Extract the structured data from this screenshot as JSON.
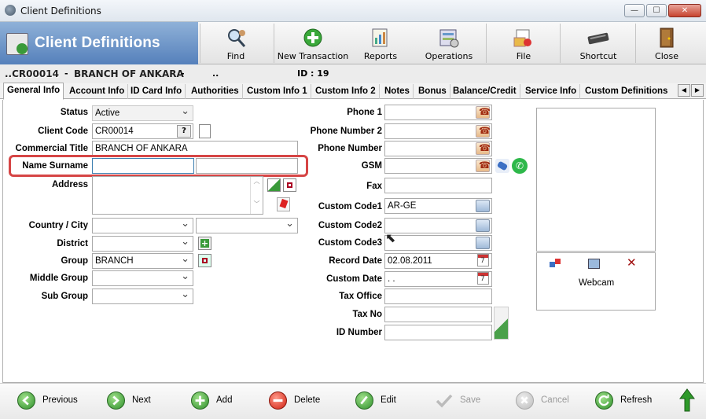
{
  "window": {
    "title": "Client Definitions",
    "min": "—",
    "max": "☐",
    "close": "✕"
  },
  "header": {
    "title": "Client Definitions"
  },
  "toolbar": [
    {
      "id": "find",
      "label": "Find",
      "icon": "find-icon"
    },
    {
      "id": "new-transaction",
      "label": "New Transaction",
      "icon": "add-icon"
    },
    {
      "id": "reports",
      "label": "Reports",
      "icon": "reports-icon"
    },
    {
      "id": "operations",
      "label": "Operations",
      "icon": "operations-icon"
    },
    {
      "id": "file",
      "label": "File",
      "icon": "file-icon"
    },
    {
      "id": "shortcut",
      "label": "Shortcut",
      "icon": "keyboard-icon"
    },
    {
      "id": "close",
      "label": "Close",
      "icon": "door-icon"
    }
  ],
  "info": {
    "code": "CR00014",
    "sep1": "-",
    "name": "BRANCH OF ANKARA",
    "sep2": "-",
    "id": "ID : 19",
    "dots": "..",
    "dots2": ".."
  },
  "tabs": [
    "General Info",
    "Account Info",
    "ID Card Info",
    "Authorities",
    "Custom Info 1",
    "Custom Info 2",
    "Notes",
    "Bonus",
    "Balance/Credit",
    "Service Info",
    "Custom Definitions"
  ],
  "form_left": {
    "status_label": "Status",
    "status": "Active",
    "client_code_label": "Client Code",
    "client_code": "CR00014",
    "code_btn": "?",
    "commercial_title_label": "Commercial Title",
    "commercial_title": "BRANCH OF ANKARA",
    "name_surname_label": "Name Surname",
    "name": "",
    "surname": "",
    "address_label": "Address",
    "address": "",
    "country_city_label": "Country / City",
    "country": "",
    "city": "",
    "district_label": "District",
    "district": "",
    "group_label": "Group",
    "group": "BRANCH",
    "middle_group_label": "Middle Group",
    "middle_group": "",
    "sub_group_label": "Sub Group",
    "sub_group": ""
  },
  "form_right": {
    "phone1_label": "Phone 1",
    "phone1": "",
    "phone_number2_label": "Phone Number 2",
    "phone_number2": "",
    "phone_number_label": "Phone Number",
    "phone_number": "",
    "gsm_label": "GSM",
    "gsm": "",
    "fax_label": "Fax",
    "fax": "",
    "custom_code1_label": "Custom Code1",
    "custom_code1": "AR-GE",
    "custom_code2_label": "Custom Code2",
    "custom_code2": "",
    "custom_code3_label": "Custom Code3",
    "custom_code3": "",
    "record_date_label": "Record Date",
    "record_date": "02.08.2011",
    "custom_date_label": "Custom Date",
    "custom_date": " . .",
    "tax_office_label": "Tax Office",
    "tax_office": "",
    "tax_no_label": "Tax No",
    "tax_no": "",
    "id_number_label": "ID Number",
    "id_number": ""
  },
  "photo": {
    "webcam_label": "Webcam"
  },
  "bottom": [
    {
      "id": "previous",
      "label": "Previous",
      "enabled": true
    },
    {
      "id": "next",
      "label": "Next",
      "enabled": true
    },
    {
      "id": "add",
      "label": "Add",
      "enabled": true
    },
    {
      "id": "delete",
      "label": "Delete",
      "enabled": true
    },
    {
      "id": "edit",
      "label": "Edit",
      "enabled": true
    },
    {
      "id": "save",
      "label": "Save",
      "enabled": false
    },
    {
      "id": "cancel",
      "label": "Cancel",
      "enabled": false
    },
    {
      "id": "refresh",
      "label": "Refresh",
      "enabled": true
    }
  ],
  "colors": {
    "header_blue": "#5580bb",
    "highlight": "#d64545",
    "green": "#2e8f2a",
    "red": "#d01f10"
  }
}
